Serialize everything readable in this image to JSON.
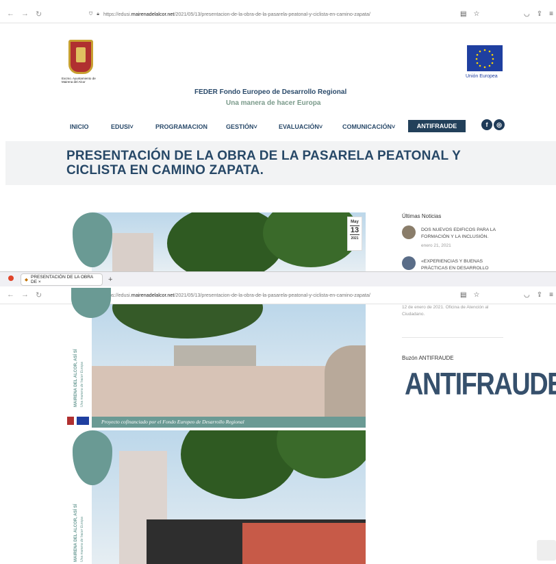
{
  "browser": {
    "url_prefix": "https://edusi.",
    "url_domain": "mairenadelalcor.net",
    "url_path": "/2021/05/13/presentacion-de-la-obra-de-la-pasarela-peatonal-y-ciclista-en-camino-zapata/",
    "tab_title": "PRESENTACIÓN DE LA OBRA DE ×",
    "new_tab": "+"
  },
  "header": {
    "town_name": "Excmo. Ayuntamiento de Mairena del Alcor",
    "eu_label": "Unión Europea",
    "fund_title": "FEDER Fondo Europeo de Desarrollo Regional",
    "fund_tagline": "Una manera de hacer Europa"
  },
  "nav": {
    "items": [
      "INICIO",
      "EDUSI",
      "PROGRAMACION",
      "GESTIÓN",
      "EVALUACIÓN",
      "COMUNICACIÓN"
    ],
    "highlight": "ANTIFRAUDE"
  },
  "post": {
    "title": "PRESENTACIÓN DE LA OBRA DE LA PASARELA PEATONAL Y CICLISTA EN CAMINO ZAPATA.",
    "date_month": "May",
    "date_day": "13",
    "date_year": "2021",
    "vertical_slogan": "MAIRENA DEL ALCOR, ASÍ SÍ",
    "vertical_sub": "Una manera de hacer Europa",
    "caption": "Proyecto cofinanciado por el Fondo Europeo de Desarrollo Regional"
  },
  "sidebar": {
    "news_heading": "Últimas Noticias",
    "news": [
      {
        "title": "DOS NUEVOS EDIFICOS PARA LA FORMACIÓN Y LA INCLUSIÓN.",
        "date": "enero 21, 2021"
      },
      {
        "title": "«EXPERIENCIAS Y BUENAS PRÁCTICAS EN DESARROLLO",
        "date": ""
      }
    ],
    "news_cut_text": "12 de enero de 2021. Oficina de Atención al Ciudadano.",
    "buzon_heading": "Buzón ANTIFRAUDE",
    "buzon_image_text": "ANTIFRAUDE"
  },
  "colors": {
    "brand": "#274867",
    "teal": "#6a9a94",
    "nav_dark": "#22405a"
  }
}
